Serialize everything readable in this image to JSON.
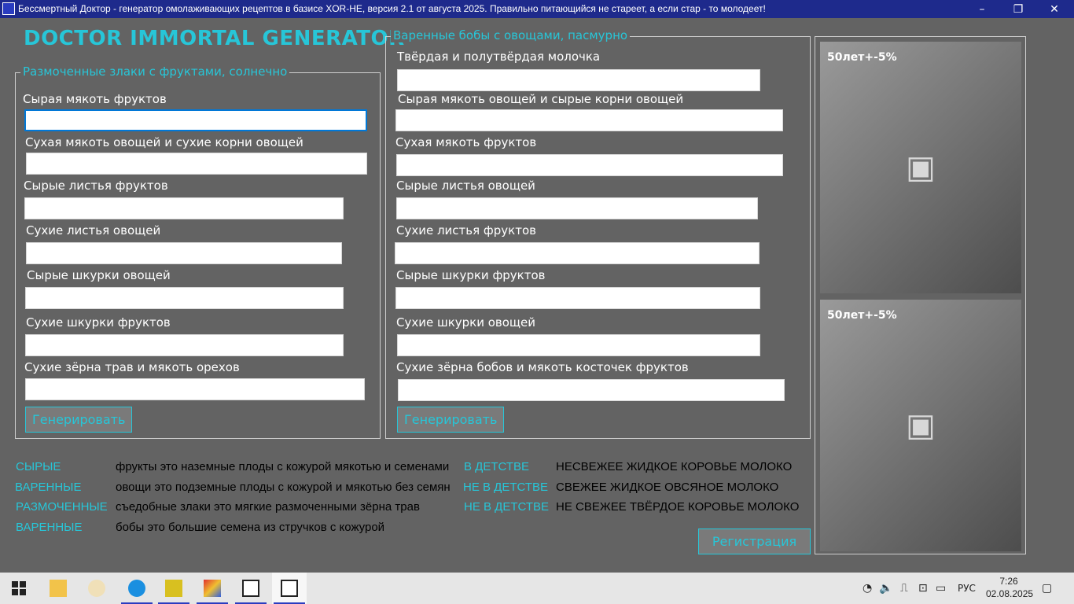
{
  "window": {
    "title": "Бессмертный Доктор - генератор омолаживающих рецептов в базисе XOR-НЕ, версия 2.1 от августа 2025. Правильно питающийся не стареет, а если стар - то молодеет!",
    "minimize": "–",
    "maximize": "❐",
    "close": "✕"
  },
  "brand": "DOCTOR IMMORTAL GENERATOR",
  "left_group": {
    "legend": "Размоченные злаки с фруктами, солнечно",
    "fields": [
      {
        "label": "Сырая мякоть фруктов",
        "value": ""
      },
      {
        "label": "Сухая мякоть овощей и сухие корни овощей",
        "value": ""
      },
      {
        "label": "Сырые листья фруктов",
        "value": ""
      },
      {
        "label": "Сухие листья овощей",
        "value": ""
      },
      {
        "label": "Сырые шкурки овощей",
        "value": ""
      },
      {
        "label": "Сухие шкурки фруктов",
        "value": ""
      },
      {
        "label": "Сухие зёрна трав и мякоть орехов",
        "value": ""
      }
    ],
    "button": "Генерировать"
  },
  "right_group": {
    "legend": "Варенные бобы с овощами, пасмурно",
    "fields": [
      {
        "label": "Твёрдая и полутвёрдая молочка",
        "value": ""
      },
      {
        "label": "Сырая мякоть овощей и сырые корни овощей",
        "value": ""
      },
      {
        "label": "Сухая мякоть фруктов",
        "value": ""
      },
      {
        "label": "Сырые листья овощей",
        "value": ""
      },
      {
        "label": "Сухие листья фруктов",
        "value": ""
      },
      {
        "label": "Сырые шкурки фруктов",
        "value": ""
      },
      {
        "label": "Сухие шкурки овощей",
        "value": ""
      },
      {
        "label": "Сухие зёрна бобов и мякоть косточек фруктов",
        "value": ""
      }
    ],
    "button": "Генерировать"
  },
  "photos": [
    {
      "caption": "50лет+-5%"
    },
    {
      "caption": "50лет+-5%"
    }
  ],
  "glossary": [
    {
      "term": "СЫРЫЕ",
      "desc": "фрукты это наземные плоды с кожурой мякотью и семенами"
    },
    {
      "term": "ВАРЕННЫЕ",
      "desc": "овощи это подземные плоды с кожурой и мякотью без семян"
    },
    {
      "term": "РАЗМОЧЕННЫЕ",
      "desc": "съедобные злаки это мягкие размоченными зёрна трав"
    },
    {
      "term": "ВАРЕННЫЕ",
      "desc": "бобы это большие семена из стручков с кожурой"
    }
  ],
  "milk": [
    {
      "term": "В ДЕТСТВЕ",
      "desc": "НЕСВЕЖЕЕ ЖИДКОЕ КОРОВЬЕ МОЛОКО"
    },
    {
      "term": "НЕ В ДЕТСТВЕ",
      "desc": "СВЕЖЕЕ ЖИДКОЕ ОВСЯНОЕ МОЛОКО"
    },
    {
      "term": "НЕ В ДЕТСТВЕ",
      "desc": "НЕ СВЕЖЕЕ ТВЁРДОЕ КОРОВЬЕ МОЛОКО"
    }
  ],
  "register_button": "Регистрация",
  "taskbar": {
    "language": "РУС",
    "time": "7:26",
    "date": "02.08.2025"
  },
  "colors": {
    "accent": "#27c6d8",
    "background": "#636363",
    "titlebar": "#1e2a8c"
  }
}
